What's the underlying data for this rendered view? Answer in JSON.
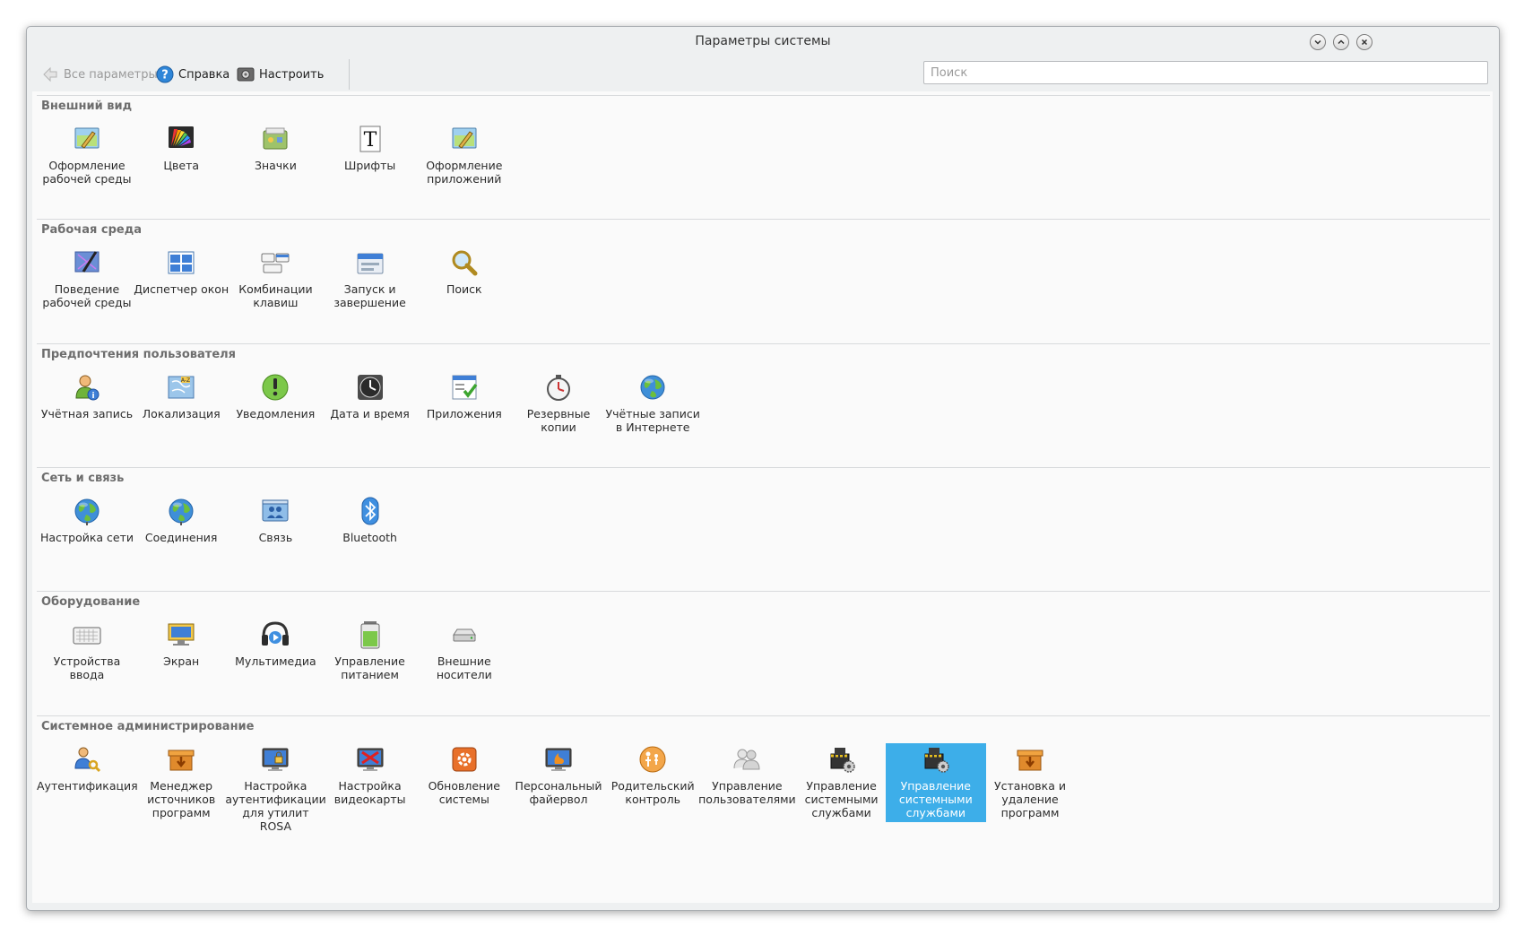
{
  "window": {
    "title": "Параметры системы"
  },
  "toolbar": {
    "back_label": "Все параметры",
    "help_label": "Справка",
    "configure_label": "Настроить",
    "search_placeholder": "Поиск",
    "search_value": ""
  },
  "sections": [
    {
      "title": "Внешний вид",
      "items": [
        {
          "label": "Оформление\nрабочей среды",
          "icon": "workspace-theme-icon"
        },
        {
          "label": "Цвета",
          "icon": "colors-icon"
        },
        {
          "label": "Значки",
          "icon": "icons-icon"
        },
        {
          "label": "Шрифты",
          "icon": "fonts-icon"
        },
        {
          "label": "Оформление\nприложений",
          "icon": "application-style-icon"
        }
      ]
    },
    {
      "title": "Рабочая среда",
      "items": [
        {
          "label": "Поведение\nрабочей среды",
          "icon": "workspace-behavior-icon"
        },
        {
          "label": "Диспетчер окон",
          "icon": "window-manager-icon"
        },
        {
          "label": "Комбинации\nклавиш",
          "icon": "shortcuts-icon"
        },
        {
          "label": "Запуск и\nзавершение",
          "icon": "startup-shutdown-icon"
        },
        {
          "label": "Поиск",
          "icon": "search-icon"
        }
      ]
    },
    {
      "title": "Предпочтения пользователя",
      "items": [
        {
          "label": "Учётная запись",
          "icon": "user-account-icon"
        },
        {
          "label": "Локализация",
          "icon": "localization-icon"
        },
        {
          "label": "Уведомления",
          "icon": "notifications-icon"
        },
        {
          "label": "Дата и время",
          "icon": "clock-icon"
        },
        {
          "label": "Приложения",
          "icon": "applications-icon"
        },
        {
          "label": "Резервные\nкопии",
          "icon": "backup-icon"
        },
        {
          "label": "Учётные записи\nв Интернете",
          "icon": "online-accounts-icon"
        }
      ]
    },
    {
      "title": "Сеть и связь",
      "items": [
        {
          "label": "Настройка сети",
          "icon": "network-settings-icon"
        },
        {
          "label": "Соединения",
          "icon": "connections-icon"
        },
        {
          "label": "Связь",
          "icon": "sharing-icon"
        },
        {
          "label": "Bluetooth",
          "icon": "bluetooth-icon"
        }
      ]
    },
    {
      "title": "Оборудование",
      "items": [
        {
          "label": "Устройства\nввода",
          "icon": "keyboard-icon"
        },
        {
          "label": "Экран",
          "icon": "display-icon"
        },
        {
          "label": "Мультимедиа",
          "icon": "multimedia-icon"
        },
        {
          "label": "Управление\nпитанием",
          "icon": "battery-icon"
        },
        {
          "label": "Внешние\nносители",
          "icon": "removable-drive-icon"
        }
      ]
    },
    {
      "title": "Системное администрирование",
      "items": [
        {
          "label": "Аутентификация",
          "icon": "authentication-icon"
        },
        {
          "label": "Менеджер\nисточников\nпрограмм",
          "icon": "software-sources-icon"
        },
        {
          "label": "Настройка\nаутентификации\nдля утилит\nROSA",
          "icon": "rosa-auth-icon"
        },
        {
          "label": "Настройка\nвидеокарты",
          "icon": "video-card-icon"
        },
        {
          "label": "Обновление\nсистемы",
          "icon": "system-update-icon"
        },
        {
          "label": "Персональный\nфайервол",
          "icon": "firewall-icon"
        },
        {
          "label": "Родительский\nконтроль",
          "icon": "parental-control-icon"
        },
        {
          "label": "Управление\nпользователями",
          "icon": "users-management-icon"
        },
        {
          "label": "Управление\nсистемными\nслужбами",
          "icon": "services-icon"
        },
        {
          "label": "Управление\nсистемными\nслужбами",
          "icon": "services-icon",
          "selected": true
        },
        {
          "label": "Установка и\nудаление\nпрограмм",
          "icon": "install-remove-icon"
        }
      ]
    }
  ]
}
